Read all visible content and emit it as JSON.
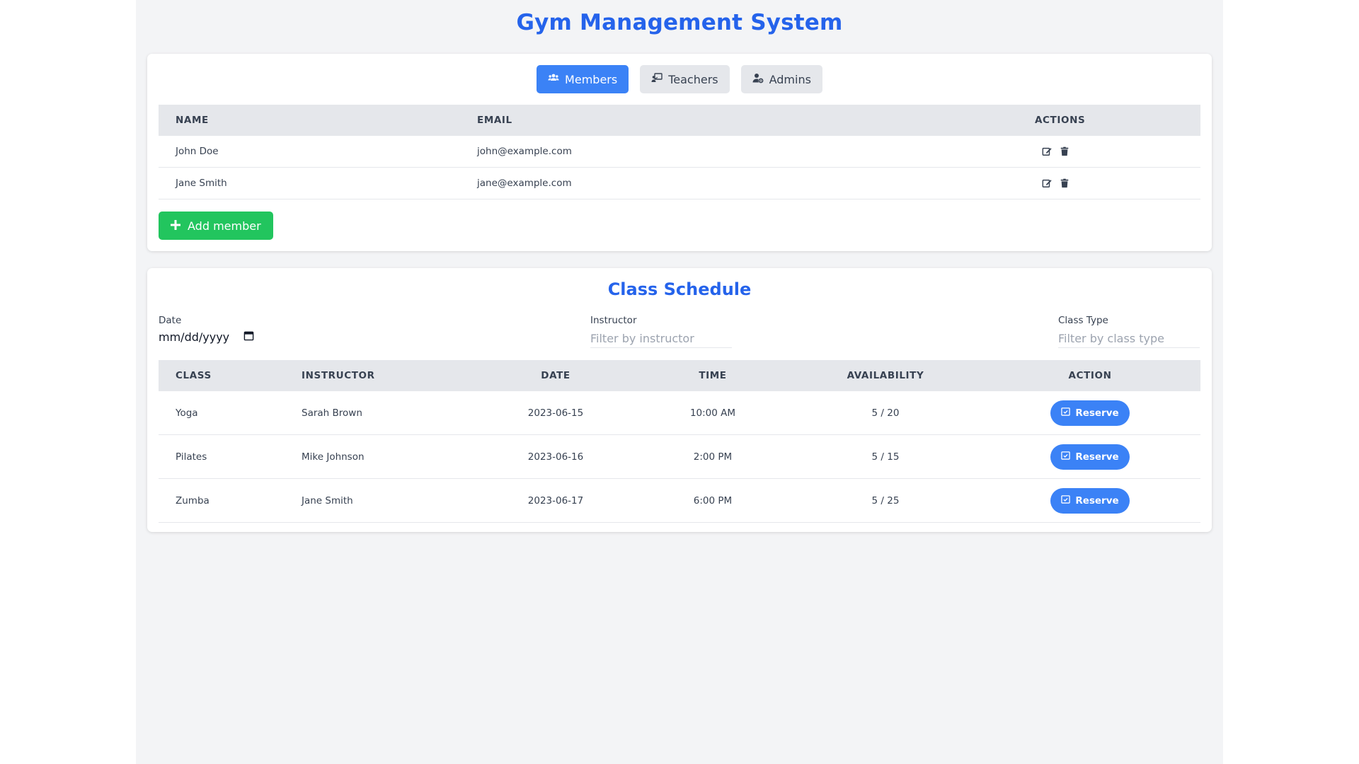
{
  "app": {
    "title": "Gym Management System"
  },
  "tabs": [
    {
      "label": "Members",
      "icon": "users-icon",
      "active": true
    },
    {
      "label": "Teachers",
      "icon": "chalkboard-teacher-icon",
      "active": false
    },
    {
      "label": "Admins",
      "icon": "user-cog-icon",
      "active": false
    }
  ],
  "members_table": {
    "headers": [
      "Name",
      "Email",
      "Actions"
    ],
    "rows": [
      {
        "name": "John Doe",
        "email": "john@example.com"
      },
      {
        "name": "Jane Smith",
        "email": "jane@example.com"
      }
    ]
  },
  "add_member_label": "Add member",
  "schedule": {
    "title": "Class Schedule",
    "filters": {
      "date_label": "Date",
      "date_value": "mm/dd/yyyy",
      "instructor_label": "Instructor",
      "instructor_placeholder": "Filter by instructor",
      "class_type_label": "Class Type",
      "class_type_placeholder": "Filter by class type"
    },
    "headers": [
      "Class",
      "Instructor",
      "Date",
      "Time",
      "Availability",
      "Action"
    ],
    "rows": [
      {
        "class": "Yoga",
        "instructor": "Sarah Brown",
        "date": "2023-06-15",
        "time": "10:00 AM",
        "availability": "5 / 20"
      },
      {
        "class": "Pilates",
        "instructor": "Mike Johnson",
        "date": "2023-06-16",
        "time": "2:00 PM",
        "availability": "5 / 15"
      },
      {
        "class": "Zumba",
        "instructor": "Jane Smith",
        "date": "2023-06-17",
        "time": "6:00 PM",
        "availability": "5 / 25"
      }
    ],
    "reserve_label": "Reserve"
  },
  "colors": {
    "primary": "#2563eb",
    "button_blue": "#3b82f6",
    "success": "#22c55e",
    "background": "#f3f4f6"
  }
}
